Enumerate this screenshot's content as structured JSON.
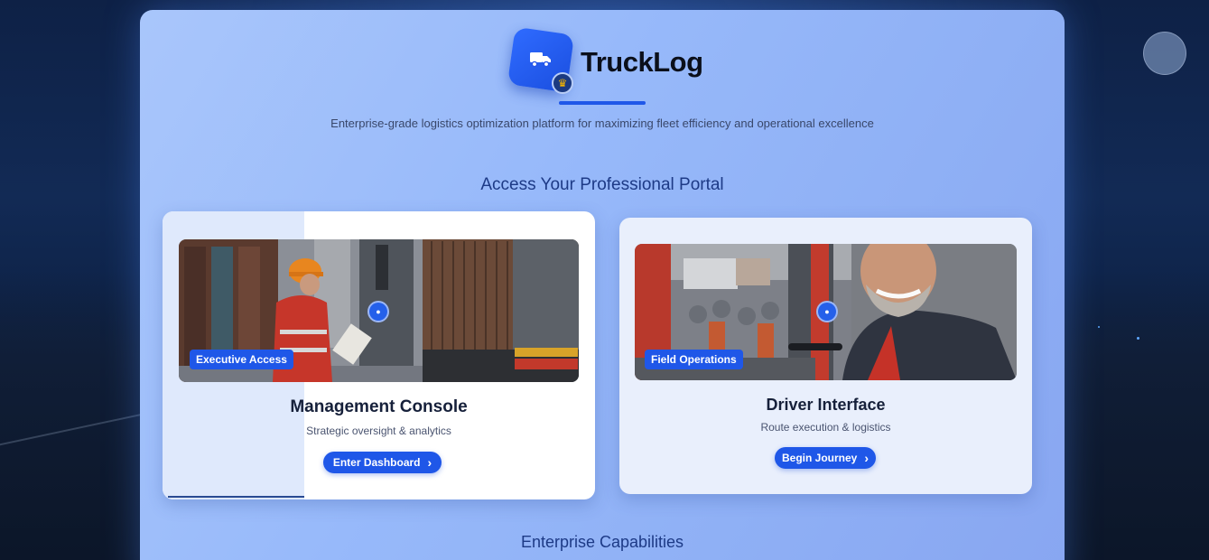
{
  "brand": {
    "name": "TruckLog",
    "logo_icon": "truck-icon",
    "badge_icon": "crown-icon",
    "tagline": "Enterprise-grade logistics optimization platform for maximizing fleet efficiency and operational excellence"
  },
  "portal": {
    "heading": "Access Your Professional Portal",
    "cards": [
      {
        "tag": "Executive Access",
        "title": "Management Console",
        "subtitle": "Strategic oversight & analytics",
        "cta": "Enter Dashboard",
        "photo_icon": "user-tie-icon"
      },
      {
        "tag": "Field Operations",
        "title": "Driver Interface",
        "subtitle": "Route execution & logistics",
        "cta": "Begin Journey",
        "photo_icon": "steering-icon"
      }
    ]
  },
  "capabilities": {
    "heading": "Enterprise Capabilities"
  },
  "colors": {
    "accent": "#1f57e8",
    "heading": "#1d3a86",
    "panel": "#97b9fa"
  }
}
